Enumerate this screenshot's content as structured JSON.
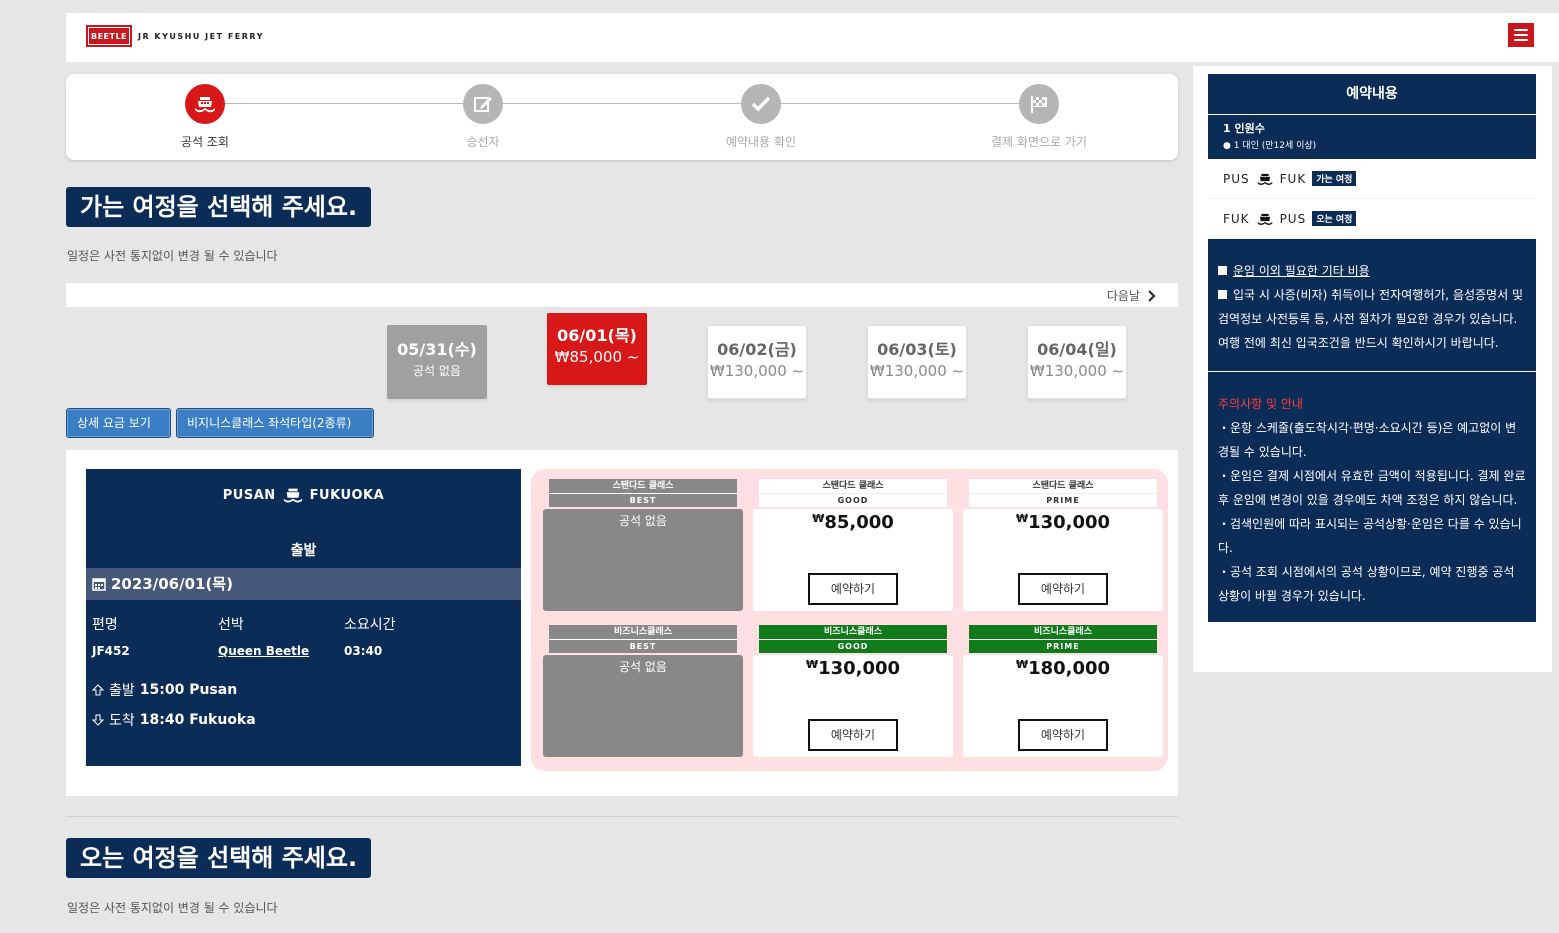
{
  "header": {
    "logo_badge": "BEETLE",
    "logo_text": "JR KYUSHU JET FERRY"
  },
  "steps": [
    {
      "label": "공석 조회",
      "active": true
    },
    {
      "label": "승선자",
      "active": false
    },
    {
      "label": "예약내용 확인",
      "active": false
    },
    {
      "label": "결제 화면으로 가기",
      "active": false
    }
  ],
  "outbound": {
    "title": "가는 여정을 선택해 주세요.",
    "note": "일정은 사전 통지없이 변경 될 수 있습니다"
  },
  "return": {
    "title": "오는 여정을 선택해 주세요.",
    "note": "일정은 사전 통지없이 변경 될 수 있습니다"
  },
  "next_day_label": "다음날",
  "dates": [
    {
      "date": "05/31(수)",
      "price": "공석 없음",
      "state": "none"
    },
    {
      "date": "06/01(목)",
      "price": "₩85,000 ~",
      "state": "selected"
    },
    {
      "date": "06/02(금)",
      "price": "₩130,000 ~",
      "state": "normal"
    },
    {
      "date": "06/03(토)",
      "price": "₩130,000 ~",
      "state": "normal"
    },
    {
      "date": "06/04(일)",
      "price": "₩130,000 ~",
      "state": "normal"
    }
  ],
  "buttons": {
    "fare_detail": "상세 요금 보기",
    "business_seat": "비지니스클래스 좌석타입(2종류)"
  },
  "trip": {
    "from": "PUSAN",
    "to": "FUKUOKA",
    "departure_label": "출발",
    "date": "2023/06/01(목)",
    "flight_header": "편명",
    "ship_header": "선박",
    "duration_header": "소요시간",
    "flight": "JF452",
    "ship": "Queen Beetle",
    "duration": "03:40",
    "dep_prefix": "출발",
    "dep_time": "15:00 Pusan",
    "arr_prefix": "도착",
    "arr_time": "18:40 Fukuoka"
  },
  "seats": [
    {
      "class": "스탠다드 클래스",
      "grade": "BEST",
      "type": "none",
      "text": "공석 없음"
    },
    {
      "class": "스탠다드 클래스",
      "grade": "GOOD",
      "type": "std",
      "currency": "₩",
      "price": "85,000",
      "button": "예약하기"
    },
    {
      "class": "스탠다드 클래스",
      "grade": "PRIME",
      "type": "std",
      "currency": "₩",
      "price": "130,000",
      "button": "예약하기"
    },
    {
      "class": "비즈니스클래스",
      "grade": "BEST",
      "type": "none",
      "text": "공석 없음"
    },
    {
      "class": "비즈니스클래스",
      "grade": "GOOD",
      "type": "biz",
      "currency": "₩",
      "price": "130,000",
      "button": "예약하기"
    },
    {
      "class": "비즈니스클래스",
      "grade": "PRIME",
      "type": "biz",
      "currency": "₩",
      "price": "180,000",
      "button": "예약하기"
    }
  ],
  "sidebar": {
    "title": "예약내용",
    "pax_count": "1 인원수",
    "pax_detail": "● 1 대인 (만12세 이상)",
    "legs": [
      {
        "from": "PUS",
        "to": "FUK",
        "badge": "가는 여정"
      },
      {
        "from": "FUK",
        "to": "PUS",
        "badge": "오는 여정"
      }
    ],
    "fees_title": "운임 이외 필요한 기타 비용",
    "fees_text": "입국 시 사증(비자) 취득이나 전자여행허가, 음성증명서 및 검역정보 사전등록 등, 사전 절차가 필요한 경우가 있습니다. 여행 전에 최신 입국조건을 반드시 확인하시기 바랍니다.",
    "notice_title": "주의사항 및 안내",
    "notices": [
      "・운항 스케줄(출도착시각·편명·소요시간 등)은 예고없이 변경될 수 있습니다.",
      "・운임은 결제 시점에서 유효한 금액이 적용됩니다. 결제 완료 후 운임에 변경이 있을 경우에도 차액 조정은 하지 않습니다.",
      "・검색인원에 따라 표시되는 공석상황·운임은 다를 수 있습니다.",
      "・공석 조회 시점에서의 공석 상황이므로, 예약 진행중 공석 상황이 바뀔 경우가 있습니다."
    ]
  },
  "colors": {
    "navy": "#0c2c58",
    "red": "#d71718",
    "green": "#117a1a",
    "grey": "#888888",
    "button_blue": "#3a7fc3"
  }
}
